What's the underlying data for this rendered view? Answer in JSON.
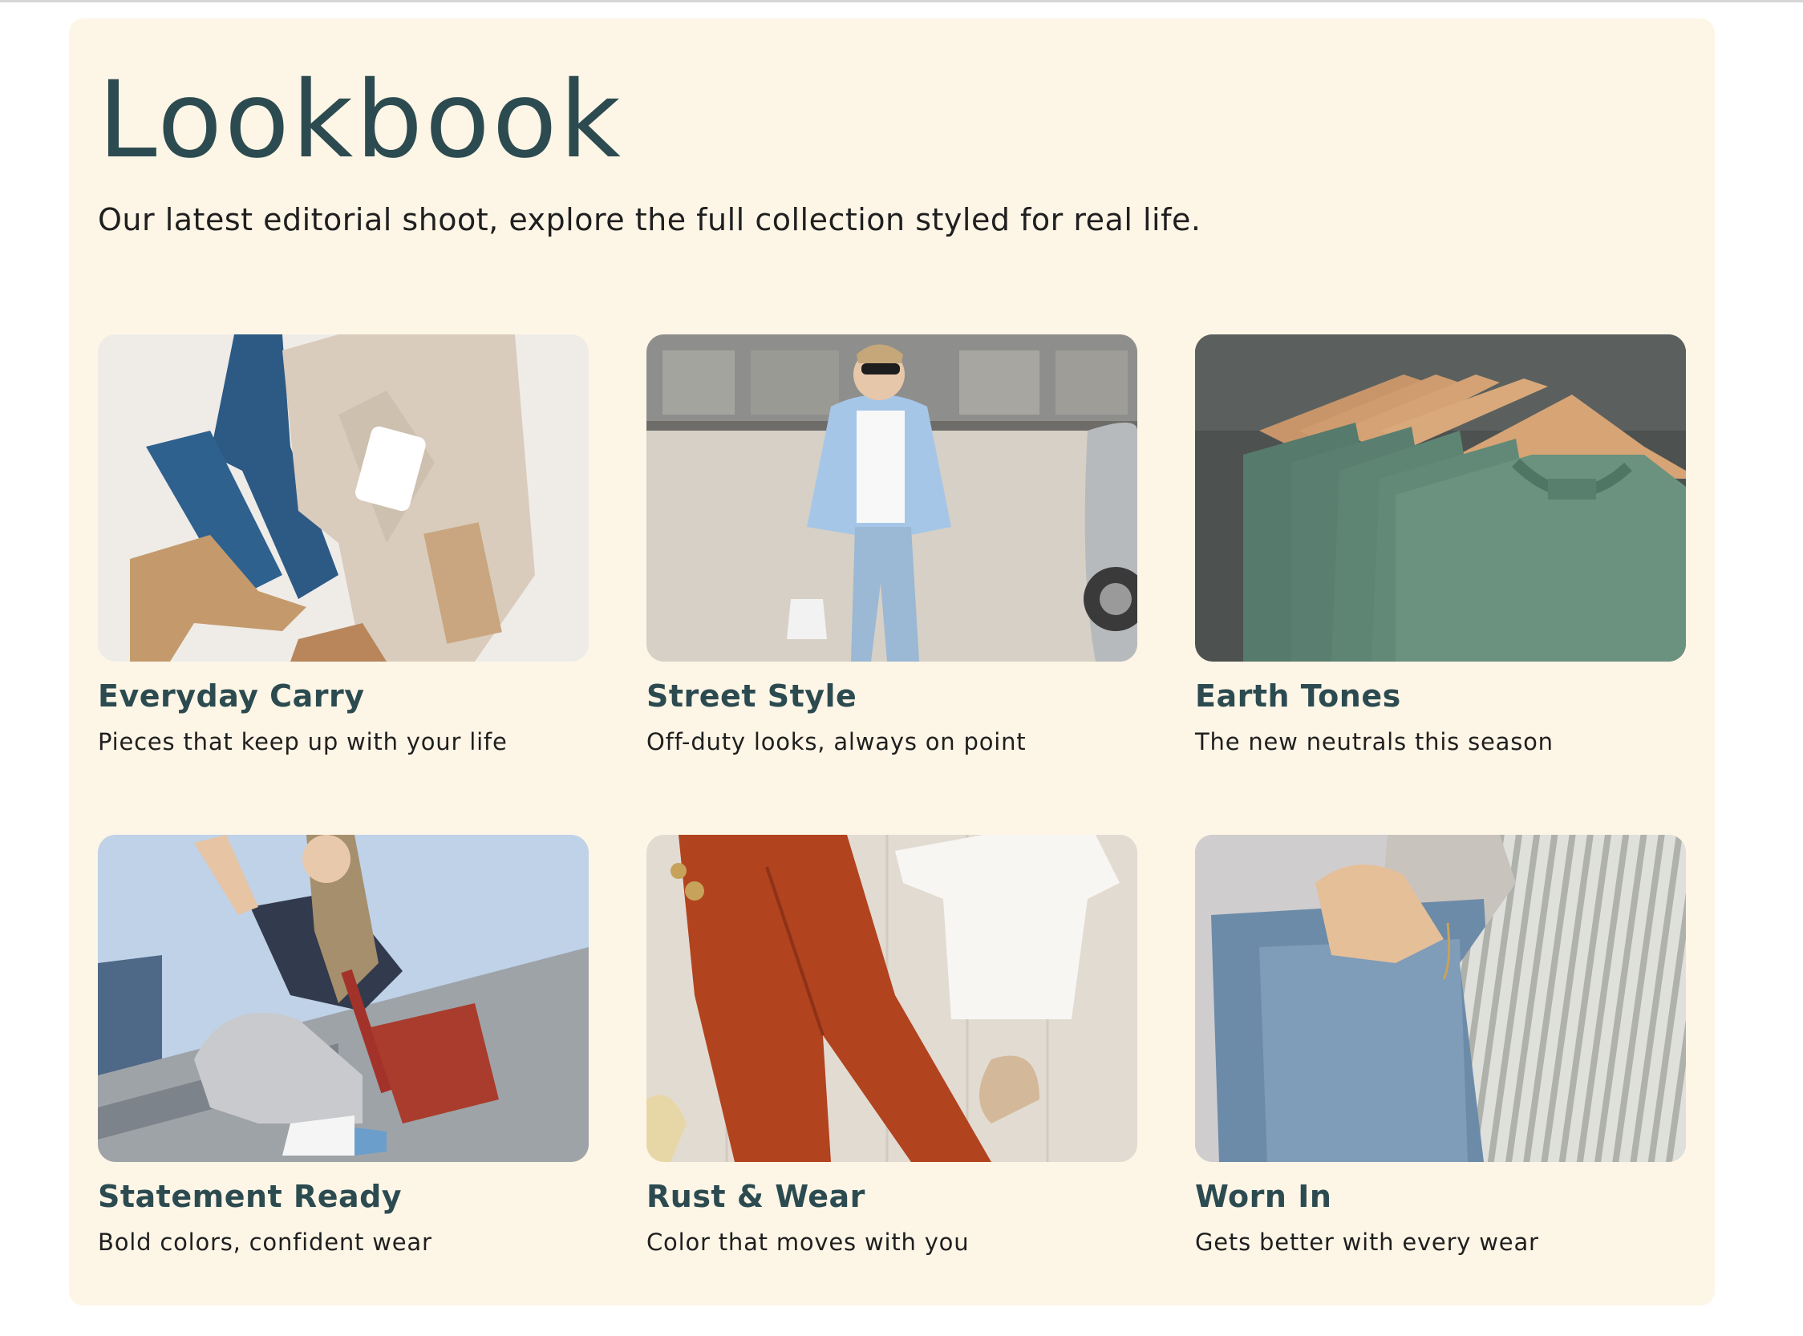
{
  "lookbook": {
    "title": "Lookbook",
    "subtitle": "Our latest editorial shoot, explore the full collection styled for real life.",
    "cards": [
      {
        "title": "Everyday Carry",
        "description": "Pieces that keep up with your life"
      },
      {
        "title": "Street Style",
        "description": "Off-duty looks, always on point"
      },
      {
        "title": "Earth Tones",
        "description": "The new neutrals this season"
      },
      {
        "title": "Statement Ready",
        "description": "Bold colors, confident wear"
      },
      {
        "title": "Rust & Wear",
        "description": "Color that moves with you"
      },
      {
        "title": "Worn In",
        "description": "Gets better with every wear"
      }
    ]
  },
  "colors": {
    "panel_background": "#fdf5e6",
    "heading": "#2c4b50",
    "body_text": "#1f1f1f"
  }
}
